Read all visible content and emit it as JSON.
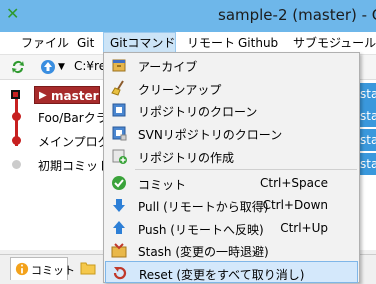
{
  "window": {
    "title": "sample-2 (master) - C"
  },
  "menubar": {
    "items": [
      "ファイル",
      "Git",
      "Gitコマンド",
      "リモート",
      "Github",
      "サブモジュール"
    ]
  },
  "toolbar": {
    "path": "C:¥re"
  },
  "log": {
    "rows": [
      {
        "label": "master",
        "status": "sta"
      },
      {
        "label": "Foo/Barクラ",
        "status": "sta"
      },
      {
        "label": "メインプログラ",
        "status": "sta"
      },
      {
        "label": "初期コミット",
        "status": "sta"
      }
    ]
  },
  "bottom": {
    "tab_commit": "コミット"
  },
  "dropdown": {
    "items": [
      {
        "label": "アーカイブ",
        "shortcut": "",
        "icon": "archive-icon"
      },
      {
        "label": "クリーンアップ",
        "shortcut": "",
        "icon": "broom-icon"
      },
      {
        "label": "リポジトリのクローン",
        "shortcut": "",
        "icon": "clone-icon"
      },
      {
        "label": "SVNリポジトリのクローン",
        "shortcut": "",
        "icon": "svn-clone-icon"
      },
      {
        "label": "リポジトリの作成",
        "shortcut": "",
        "icon": "create-repo-icon"
      },
      {
        "label": "コミット",
        "shortcut": "Ctrl+Space",
        "icon": "commit-check-icon"
      },
      {
        "label": "Pull (リモートから取得)",
        "shortcut": "Ctrl+Down",
        "icon": "pull-arrow-icon"
      },
      {
        "label": "Push (リモートへ反映)",
        "shortcut": "Ctrl+Up",
        "icon": "push-arrow-icon"
      },
      {
        "label": "Stash (変更の一時退避)",
        "shortcut": "",
        "icon": "stash-icon"
      },
      {
        "label": "Reset (変更をすべて取り消し)",
        "shortcut": "",
        "icon": "reset-icon"
      }
    ]
  },
  "colors": {
    "titlebar": "#6eb7ea",
    "branch": "#a72b2b",
    "highlight": "#d4e8fb"
  }
}
